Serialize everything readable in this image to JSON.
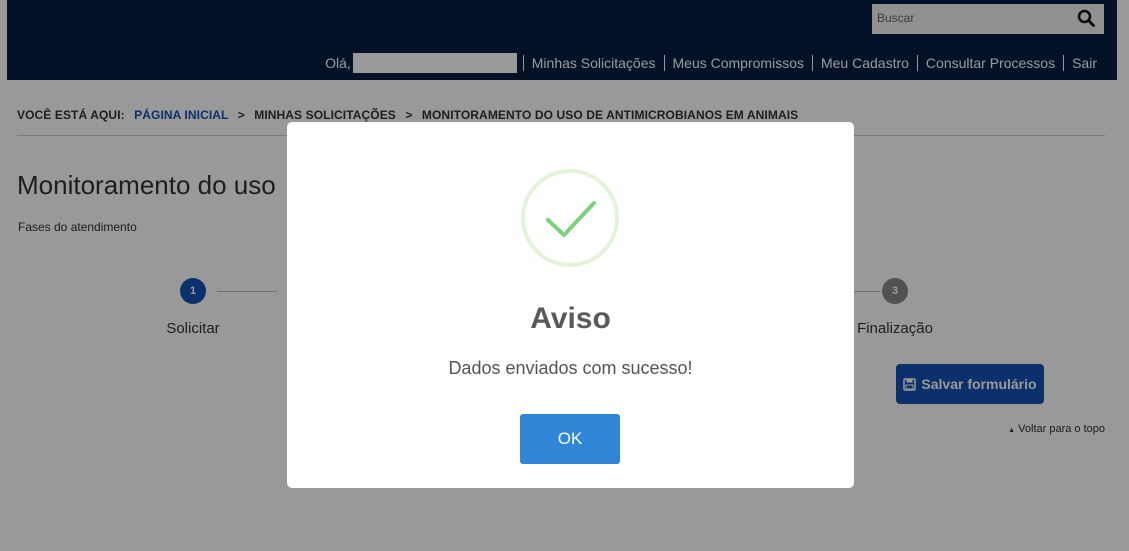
{
  "header": {
    "search_placeholder": "Buscar",
    "greeting": "Olá,",
    "nav": [
      "Minhas Solicitações",
      "Meus Compromissos",
      "Meu Cadastro",
      "Consultar Processos",
      "Sair"
    ]
  },
  "breadcrumb": {
    "prefix": "VOCÊ ESTÁ AQUI:",
    "items": [
      "PÁGINA INICIAL",
      "MINHAS SOLICITAÇÕES",
      "MONITORAMENTO DO USO DE ANTIMICROBIANOS EM ANIMAIS"
    ],
    "separator": ">"
  },
  "page": {
    "title": "Monitoramento do uso",
    "phases_label": "Fases do atendimento",
    "steps": [
      {
        "number": "1",
        "label": "Solicitar",
        "color": "#1351b4"
      },
      {
        "number": "3",
        "label": "Finalização",
        "color": "#888888"
      }
    ],
    "save_button": "Salvar formulário",
    "back_to_top": "Voltar para o topo"
  },
  "modal": {
    "title": "Aviso",
    "message": "Dados enviados com sucesso!",
    "ok_button": "OK",
    "icon": "success-check-icon",
    "accent": "#3085d6"
  }
}
